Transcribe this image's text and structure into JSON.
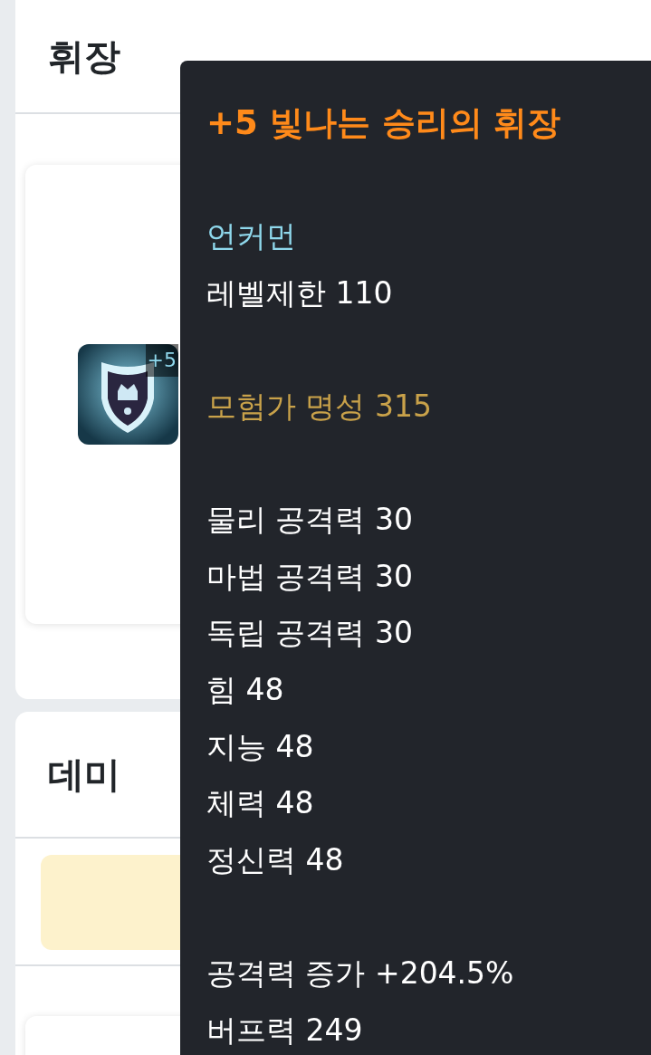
{
  "panels": [
    {
      "title": "휘장",
      "item": {
        "badge": "+5"
      }
    },
    {
      "title": "데미"
    }
  ],
  "tooltip": {
    "title": "+5 빛나는 승리의 휘장",
    "sections": [
      [
        {
          "kind": "rarity",
          "text": "언커먼"
        },
        {
          "kind": "plain",
          "text": "레벨제한 110"
        }
      ],
      [
        {
          "kind": "fame",
          "text": "모험가 명성 315"
        }
      ],
      [
        {
          "kind": "plain",
          "text": "물리 공격력 30"
        },
        {
          "kind": "plain",
          "text": "마법 공격력 30"
        },
        {
          "kind": "plain",
          "text": "독립 공격력 30"
        },
        {
          "kind": "plain",
          "text": "힘 48"
        },
        {
          "kind": "plain",
          "text": "지능 48"
        },
        {
          "kind": "plain",
          "text": "체력 48"
        },
        {
          "kind": "plain",
          "text": "정신력 48"
        }
      ],
      [
        {
          "kind": "plain",
          "text": "공격력 증가 +204.5%"
        },
        {
          "kind": "plain",
          "text": "버프력 249"
        }
      ]
    ]
  }
}
